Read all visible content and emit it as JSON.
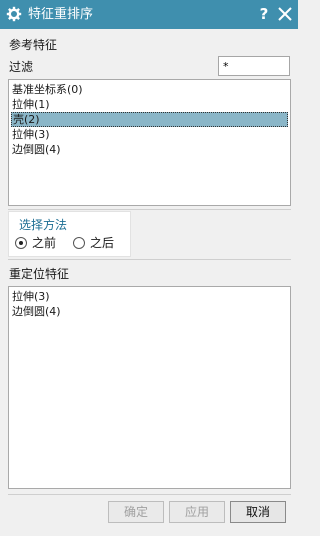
{
  "titlebar": {
    "title": "特征重排序",
    "help": "?"
  },
  "reference": {
    "section_label": "参考特征",
    "filter_label": "过滤",
    "filter_value": "*",
    "items": [
      {
        "label": "基准坐标系(0)",
        "selected": false
      },
      {
        "label": "拉伸(1)",
        "selected": false
      },
      {
        "label": "壳(2)",
        "selected": true
      },
      {
        "label": "拉伸(3)",
        "selected": false
      },
      {
        "label": "边倒圆(4)",
        "selected": false
      }
    ]
  },
  "method": {
    "title": "选择方法",
    "options": [
      {
        "label": "之前",
        "checked": true
      },
      {
        "label": "之后",
        "checked": false
      }
    ]
  },
  "reposition": {
    "section_label": "重定位特征",
    "items": [
      {
        "label": "拉伸(3)"
      },
      {
        "label": "边倒圆(4)"
      }
    ]
  },
  "buttons": {
    "ok": "确定",
    "apply": "应用",
    "cancel": "取消"
  },
  "colors": {
    "titlebar": "#3f8fae",
    "selection": "#8ab6c8",
    "group_title": "#1d6e93"
  }
}
